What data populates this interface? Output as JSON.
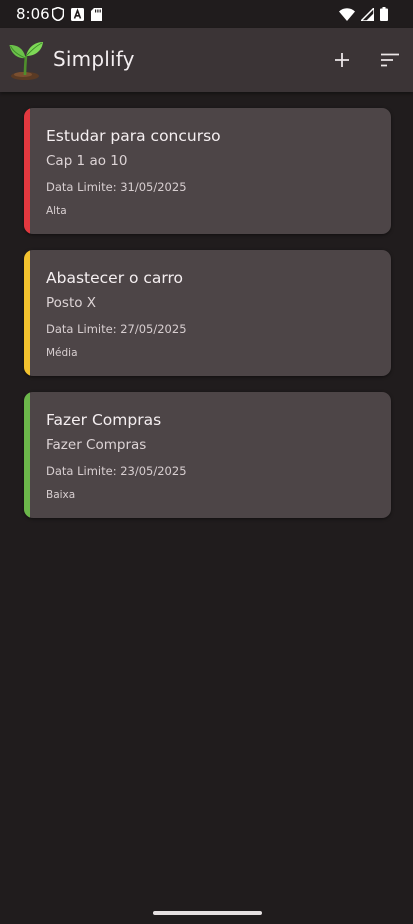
{
  "status_bar": {
    "time": "8:06",
    "icons_left": [
      "shield-icon",
      "a-badge-icon",
      "sd-card-icon"
    ],
    "icons_right": [
      "wifi-icon",
      "signal-icon",
      "battery-icon"
    ]
  },
  "app_bar": {
    "title": "Simplify",
    "logo": "sprout-icon",
    "actions": [
      "add-icon",
      "sort-icon"
    ]
  },
  "tasks": [
    {
      "title": "Estudar para concurso",
      "description": "Cap 1 ao 10",
      "deadline": "Data Limite: 31/05/2025",
      "priority": "Alta",
      "color": "#e2383f"
    },
    {
      "title": "Abastecer o carro",
      "description": "Posto X",
      "deadline": "Data Limite: 27/05/2025",
      "priority": "Média",
      "color": "#f2c12e"
    },
    {
      "title": "Fazer Compras",
      "description": "Fazer Compras",
      "deadline": "Data Limite: 23/05/2025",
      "priority": "Baixa",
      "color": "#6bb64a"
    }
  ],
  "colors": {
    "background": "#201c1d",
    "app_bar": "#3b3436",
    "card": "#4d4547"
  }
}
